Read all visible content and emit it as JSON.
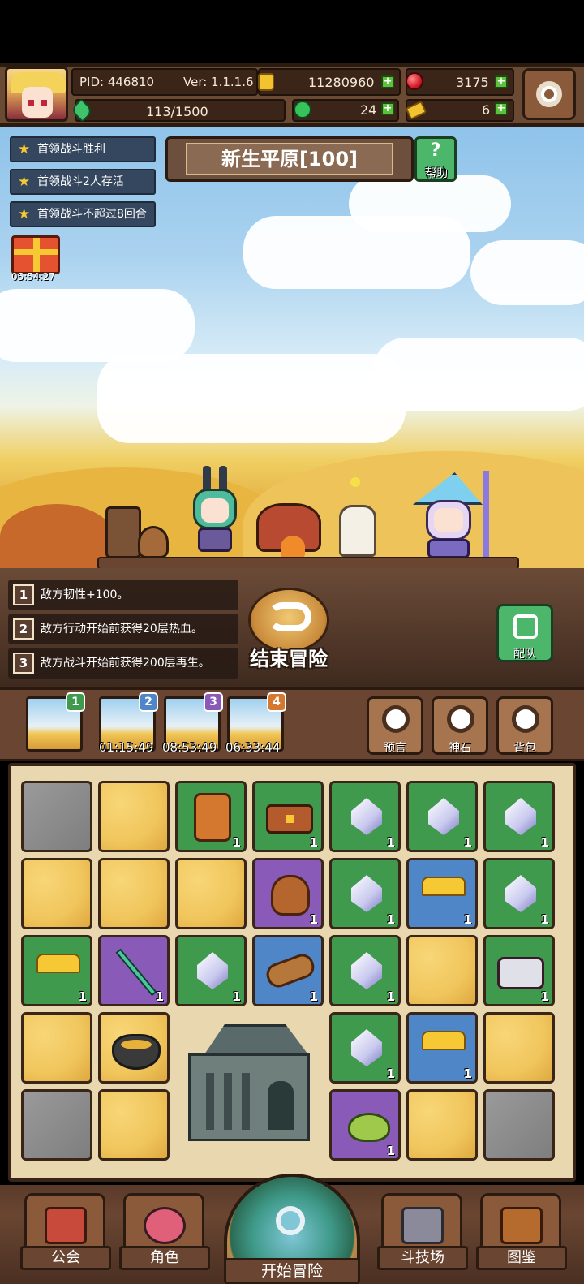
{
  "header": {
    "pid": "PID: 446810",
    "version": "Ver: 1.1.1.6",
    "gold": "11280960",
    "ruby": "3175",
    "energy": "113/1500",
    "clover": "24",
    "keys": "6"
  },
  "quests": [
    "首领战斗胜利",
    "首领战斗2人存活",
    "首领战斗不超过8回合"
  ],
  "stage": {
    "title": "新生平原[100]",
    "help_label": "帮助",
    "gift_timer": "05:54:27"
  },
  "conditions": [
    {
      "num": "1",
      "text": "敌方韧性+100。"
    },
    {
      "num": "2",
      "text": "敌方行动开始前获得20层热血。"
    },
    {
      "num": "3",
      "text": "敌方战斗开始前获得200层再生。"
    }
  ],
  "actions": {
    "end_adventure": "结束冒险",
    "team": "配队"
  },
  "slots": [
    {
      "badge": "1",
      "timer": "",
      "color": "#3f9a4e"
    },
    {
      "badge": "2",
      "timer": "01:15:49",
      "color": "#4f86c7"
    },
    {
      "badge": "3",
      "timer": "08:53:49",
      "color": "#8a5ab8"
    },
    {
      "badge": "4",
      "timer": "06:33:44",
      "color": "#d4782f"
    }
  ],
  "mini_buttons": {
    "prophecy": "预言",
    "godstone": "神石",
    "backpack": "背包"
  },
  "grid": {
    "rows": [
      [
        {
          "type": "stone"
        },
        {
          "type": "sand"
        },
        {
          "type": "green",
          "item": "gem-tablet",
          "qty": "1"
        },
        {
          "type": "green",
          "item": "chest",
          "qty": "1"
        },
        {
          "type": "green",
          "item": "crystal",
          "qty": "1"
        },
        {
          "type": "green",
          "item": "crystal",
          "qty": "1"
        },
        {
          "type": "green",
          "item": "crystal",
          "qty": "1"
        }
      ],
      [
        {
          "type": "sand"
        },
        {
          "type": "sand"
        },
        {
          "type": "sand"
        },
        {
          "type": "purple",
          "item": "bag",
          "qty": "1"
        },
        {
          "type": "green",
          "item": "crystal",
          "qty": "1"
        },
        {
          "type": "blue",
          "item": "goldpile",
          "qty": "1"
        },
        {
          "type": "green",
          "item": "crystal",
          "qty": "1"
        }
      ],
      [
        {
          "type": "green",
          "item": "goldpile",
          "qty": "1"
        },
        {
          "type": "purple",
          "item": "staff",
          "qty": "1"
        },
        {
          "type": "green",
          "item": "crystal",
          "qty": "1"
        },
        {
          "type": "blue",
          "item": "log",
          "qty": "1"
        },
        {
          "type": "green",
          "item": "crystal",
          "qty": "1"
        },
        {
          "type": "sand"
        },
        {
          "type": "green",
          "item": "mimic",
          "qty": "1"
        }
      ],
      [
        {
          "type": "sand"
        },
        {
          "type": "sand",
          "item": "pot"
        },
        {
          "type": "sand"
        },
        {
          "type": "sand"
        },
        {
          "type": "green",
          "item": "crystal",
          "qty": "1"
        },
        {
          "type": "blue",
          "item": "goldpile",
          "qty": "1"
        },
        {
          "type": "sand"
        }
      ],
      [
        {
          "type": "stone"
        },
        {
          "type": "sand"
        },
        {
          "type": "sand"
        },
        {
          "type": "sand"
        },
        {
          "type": "purple",
          "item": "seed",
          "qty": "1"
        },
        {
          "type": "sand"
        },
        {
          "type": "stone"
        }
      ]
    ]
  },
  "nav": {
    "guild": "公会",
    "character": "角色",
    "start": "开始冒险",
    "arena": "斗技场",
    "codex": "图鉴"
  }
}
